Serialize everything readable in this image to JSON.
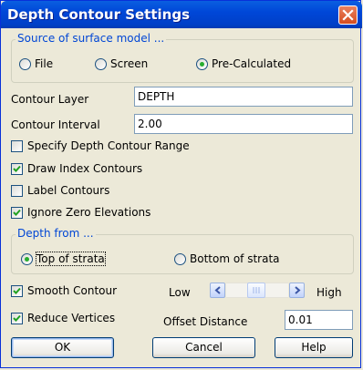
{
  "window": {
    "title": "Depth Contour Settings"
  },
  "source_group": {
    "title": "Source of surface model ...",
    "options": [
      {
        "label": "File",
        "selected": false
      },
      {
        "label": "Screen",
        "selected": false
      },
      {
        "label": "Pre-Calculated",
        "selected": true
      }
    ]
  },
  "contour_layer": {
    "label": "Contour Layer",
    "value": "DEPTH"
  },
  "contour_interval": {
    "label": "Contour Interval",
    "value": "2.00"
  },
  "checkboxes": [
    {
      "label": "Specify Depth Contour Range",
      "checked": false
    },
    {
      "label": "Draw Index Contours",
      "checked": true
    },
    {
      "label": "Label Contours",
      "checked": false
    },
    {
      "label": "Ignore Zero Elevations",
      "checked": true
    }
  ],
  "depth_group": {
    "title": "Depth from ...",
    "options": [
      {
        "label": "Top of strata",
        "selected": true
      },
      {
        "label": "Bottom of strata",
        "selected": false
      }
    ]
  },
  "smooth": {
    "label": "Smooth Contour",
    "checked": true,
    "low_label": "Low",
    "high_label": "High",
    "level": 0.5
  },
  "reduce": {
    "label": "Reduce Vertices",
    "checked": true
  },
  "offset": {
    "label": "Offset Distance",
    "value": "0.01"
  },
  "buttons": {
    "ok": "OK",
    "cancel": "Cancel",
    "help": "Help"
  },
  "icons": {
    "close": "close-icon",
    "checkmark": "checkmark-icon",
    "slider_left": "chevron-left-icon",
    "slider_right": "chevron-right-icon"
  },
  "colors": {
    "title_bar": "#0047d8",
    "group_title": "#0046d5",
    "radio_dot": "#27ad2f",
    "check": "#21a121"
  }
}
